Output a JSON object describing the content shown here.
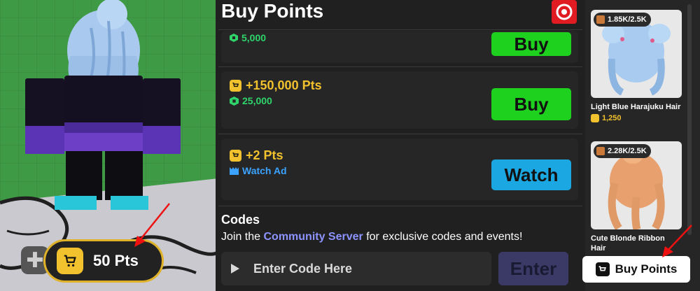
{
  "hud": {
    "points_label": "50 Pts",
    "plus_symbol": "✚"
  },
  "panel": {
    "title": "Buy Points",
    "offers": [
      {
        "amount": "",
        "price": "5,000",
        "button": "Buy"
      },
      {
        "amount": "+150,000 Pts",
        "price": "25,000",
        "button": "Buy"
      },
      {
        "amount": "+2 Pts",
        "price": "Watch Ad",
        "button": "Watch"
      }
    ],
    "codes": {
      "title": "Codes",
      "desc_prefix": "Join the ",
      "desc_link": "Community Server",
      "desc_suffix": " for exclusive codes and events!",
      "input_placeholder": "Enter Code Here",
      "enter_label": "Enter"
    }
  },
  "shop": {
    "items": [
      {
        "stock": "1.85K/2.5K",
        "name": "Light Blue Harajuku Hair",
        "price": "1,250"
      },
      {
        "stock": "2.28K/2.5K",
        "name": "Cute Blonde Ribbon Hair",
        "price": ""
      }
    ],
    "buy_points_label": "Buy Points"
  },
  "colors": {
    "accent_gold": "#f2c12e",
    "buy_green": "#1fd11f",
    "watch_blue": "#1ba7e2",
    "robux_green": "#2fd46b",
    "close_red": "#e11b22",
    "link": "#8d93ff"
  },
  "icons": [
    "cart-icon",
    "robux-icon",
    "ad-icon",
    "play-icon",
    "close-icon",
    "box-icon"
  ]
}
